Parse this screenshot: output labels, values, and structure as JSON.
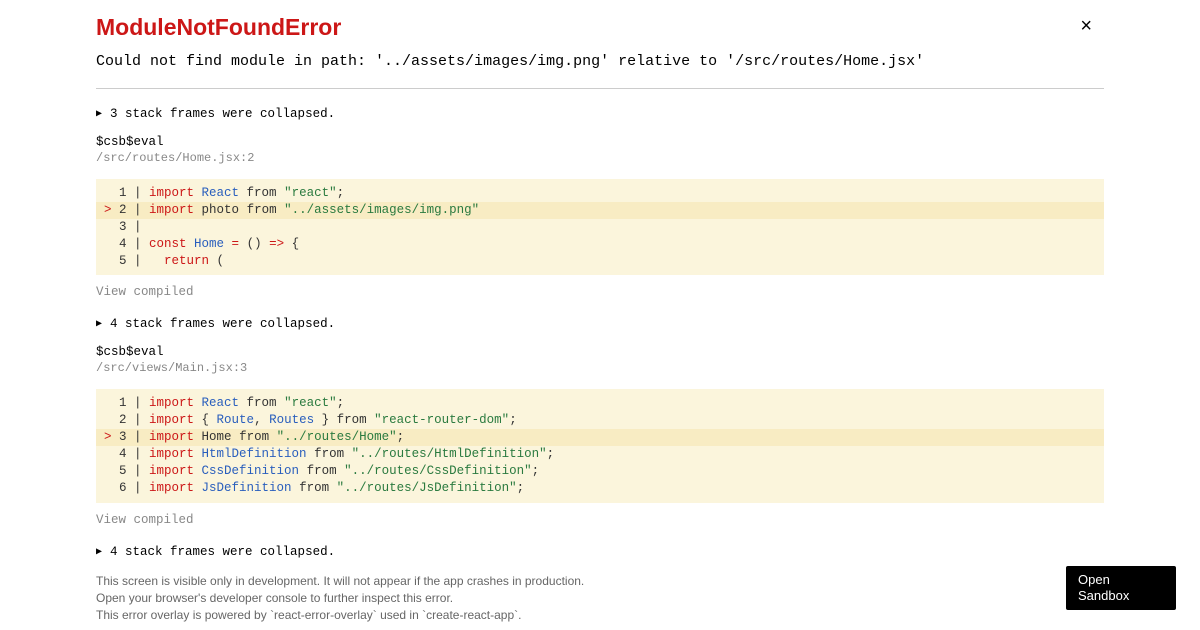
{
  "error": {
    "title": "ModuleNotFoundError",
    "message": "Could not find module in path: '../assets/images/img.png' relative to '/src/routes/Home.jsx'"
  },
  "close_label": "×",
  "frames": [
    {
      "collapsed": "3 stack frames were collapsed.",
      "name": "$csb$eval",
      "location": "/src/routes/Home.jsx:2"
    },
    {
      "collapsed": "4 stack frames were collapsed.",
      "name": "$csb$eval",
      "location": "/src/views/Main.jsx:3"
    },
    {
      "collapsed": "4 stack frames were collapsed."
    }
  ],
  "code1": {
    "l1": {
      "pre": "  1 | ",
      "kw": "import",
      "v": " React ",
      "from": "from",
      "q1": " \"",
      "str": "react",
      "q2": "\"",
      "end": ";"
    },
    "l2": {
      "pre": "> ",
      "num": "2 | ",
      "kw": "import",
      "v": " photo ",
      "from": "from",
      "q1": " \"",
      "str": "../assets/images/img.png",
      "q2": "\""
    },
    "l3": {
      "pre": "  3 | "
    },
    "l4": {
      "pre": "  4 | ",
      "kw": "const",
      "v": " Home ",
      "eq": "=",
      "p1": " () ",
      "ar": "=>",
      "p2": " {"
    },
    "l5": {
      "pre": "  5 |   ",
      "kw": "return",
      "p": " ("
    }
  },
  "code2": {
    "l1": {
      "pre": "  1 | ",
      "kw": "import",
      "v": " React ",
      "from": "from",
      "q1": " \"",
      "str": "react",
      "q2": "\"",
      "end": ";"
    },
    "l2": {
      "pre": "  2 | ",
      "kw": "import",
      "b1": " { ",
      "n1": "Route",
      "c": ", ",
      "n2": "Routes",
      "b2": " } ",
      "from": "from",
      "q1": " \"",
      "str": "react-router-dom",
      "q2": "\"",
      "end": ";"
    },
    "l3": {
      "pre": "> ",
      "num": "3 | ",
      "kw": "import",
      "v": " Home ",
      "from": "from",
      "q1": " \"",
      "str": "../routes/Home",
      "q2": "\"",
      "end": ";"
    },
    "l4": {
      "pre": "  4 | ",
      "kw": "import",
      "v": " HtmlDefinition ",
      "from": "from",
      "q1": " \"",
      "str": "../routes/HtmlDefinition",
      "q2": "\"",
      "end": ";"
    },
    "l5": {
      "pre": "  5 | ",
      "kw": "import",
      "v": " CssDefinition ",
      "from": "from",
      "q1": " \"",
      "str": "../routes/CssDefinition",
      "q2": "\"",
      "end": ";"
    },
    "l6": {
      "pre": "  6 | ",
      "kw": "import",
      "v": " JsDefinition ",
      "from": "from",
      "q1": " \"",
      "str": "../routes/JsDefinition",
      "q2": "\"",
      "end": ";"
    }
  },
  "view_compiled": "View compiled",
  "footer": {
    "l1": "This screen is visible only in development. It will not appear if the app crashes in production.",
    "l2": "Open your browser's developer console to further inspect this error.",
    "l3": "This error overlay is powered by `react-error-overlay` used in `create-react-app`."
  },
  "sandbox_button": "Open Sandbox"
}
